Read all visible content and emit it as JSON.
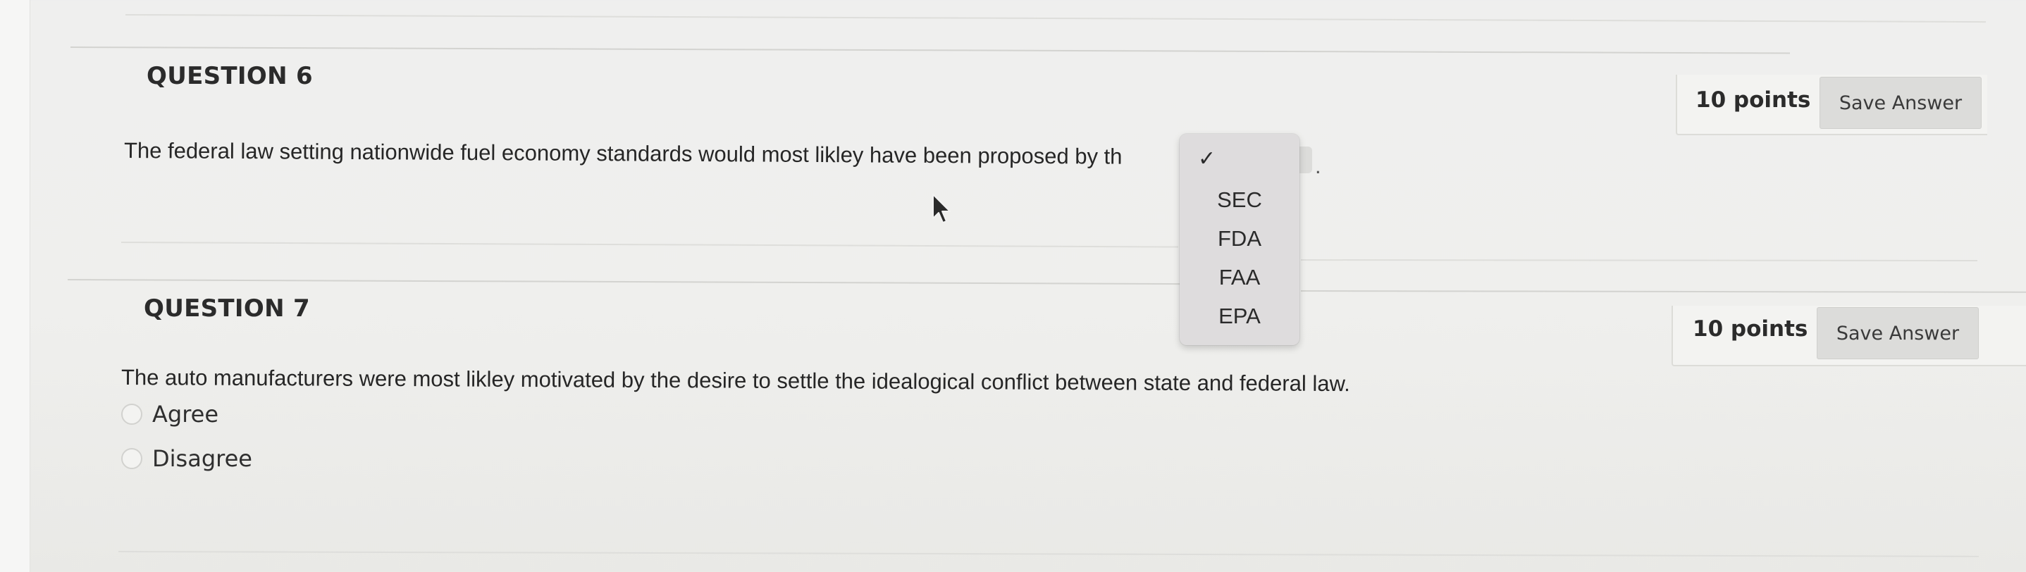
{
  "question6": {
    "title": "QUESTION 6",
    "points": "10 points",
    "save_label": "Save Answer",
    "text": "The federal law setting nationwide fuel economy standards would most likley have been proposed by th",
    "dropdown": {
      "selected_mark": "✓",
      "options": [
        "SEC",
        "FDA",
        "FAA",
        "EPA"
      ],
      "trailing_text": "."
    }
  },
  "question7": {
    "title": "QUESTION 7",
    "points": "10 points",
    "save_label": "Save Answer",
    "text": "The auto manufacturers were most likley motivated by the desire to settle the idealogical conflict between state and federal law.",
    "options": [
      "Agree",
      "Disagree"
    ]
  }
}
